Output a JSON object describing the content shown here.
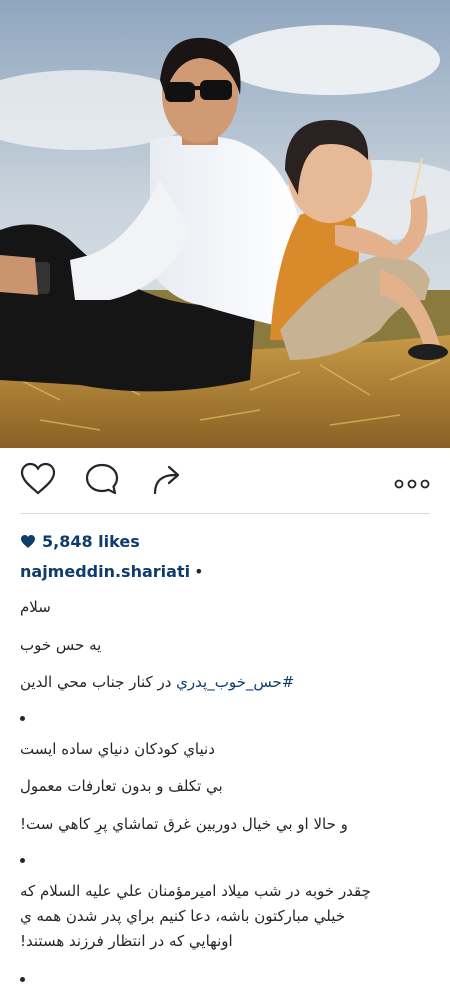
{
  "post": {
    "likes": "5,848 likes",
    "username": "najmeddin.shariati",
    "user_dot": "•"
  },
  "icons": {
    "like": "heart-outline-icon",
    "comment": "comment-bubble-icon",
    "share": "share-arrow-icon",
    "more": "more-dots-icon",
    "likes_heart": "heart-filled-icon"
  },
  "colors": {
    "link": "#0f3d6b",
    "text": "#262626",
    "divider": "#dbdbdb"
  },
  "caption": {
    "line1": "سلام",
    "line2": "يه حس خوب",
    "line3_hashtag": "#حس_خوب_پدري",
    "line3_rest": " در كنار جناب محي الدين",
    "line4": "دنياي كودكان دنياي ساده ايست",
    "line5": "بي تكلف و بدون تعارفات معمول",
    "line6": "و حالا او بي خيال دوربين غرق تماشاي پرِ كاهي ست!",
    "line7": "چقدر خوبه در شب ميلاد اميرمؤمنان علي عليه السلام كه",
    "line8": "خيلي مباركتون باشه، دعا كنيم براي پدر شدن همه ي",
    "line9": "اونهايي كه در انتظار فرزند هستند!"
  }
}
